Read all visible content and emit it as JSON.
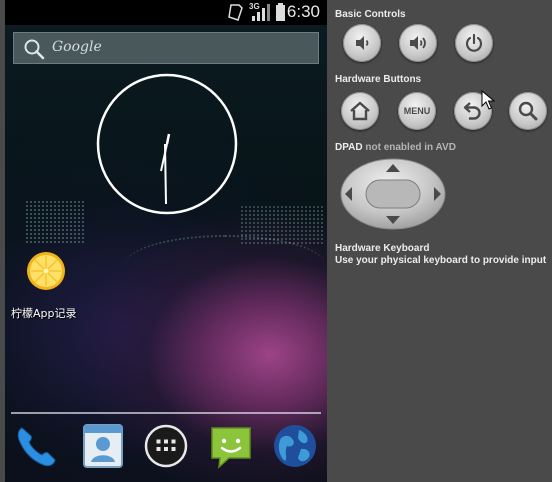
{
  "status_bar": {
    "time": "6:30",
    "network_type": "3G",
    "icons": [
      "sim-icon",
      "signal-icon",
      "battery-icon"
    ]
  },
  "search": {
    "placeholder": "Google"
  },
  "home": {
    "apps": [
      {
        "label": "柠檬App记录",
        "icon": "lemon-icon"
      }
    ],
    "dock": [
      "phone-icon",
      "contacts-icon",
      "app-drawer-icon",
      "messaging-icon",
      "browser-icon"
    ]
  },
  "panel": {
    "basic_controls": {
      "title": "Basic Controls",
      "buttons": [
        "volume-down-icon",
        "volume-up-icon",
        "power-icon"
      ]
    },
    "hardware_buttons": {
      "title": "Hardware Buttons",
      "buttons": [
        "home-icon",
        "menu",
        "back-icon",
        "search-icon"
      ],
      "menu_label": "MENU"
    },
    "dpad": {
      "title": "DPAD",
      "note": "not enabled in AVD"
    },
    "keyboard": {
      "title": "Hardware Keyboard",
      "description": "Use your physical keyboard to provide input"
    }
  },
  "colors": {
    "panel_bg": "#4a4a4a",
    "button_face": "#c9c9c9",
    "status_bar_bg": "#000000"
  }
}
